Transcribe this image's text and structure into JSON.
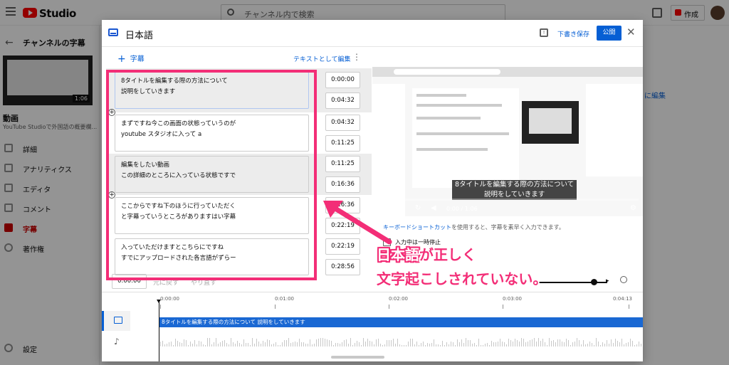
{
  "studio": {
    "logo_text": "Studio",
    "search_placeholder": "チャンネル内で検索",
    "create_label": "作成"
  },
  "sidebar": {
    "title": "チャンネルの字幕",
    "thumbnail_duration": "1:06",
    "video_title": "動画",
    "video_desc": "YouTube Studioで外国語の概要欄...",
    "items": [
      {
        "label": "詳細",
        "icon": "pencil-icon"
      },
      {
        "label": "アナリティクス",
        "icon": "analytics-icon"
      },
      {
        "label": "エディタ",
        "icon": "editor-icon"
      },
      {
        "label": "コメント",
        "icon": "comment-icon"
      },
      {
        "label": "字幕",
        "icon": "subtitles-icon"
      },
      {
        "label": "著作権",
        "icon": "copyright-icon"
      }
    ],
    "settings_label": "設定"
  },
  "background_right_text": "に編集",
  "dialog": {
    "title": "日本語",
    "save_draft": "下書き保存",
    "publish": "公開",
    "add_caption": "字幕",
    "edit_as_text": "テキストとして編集",
    "captions": [
      {
        "text1": "8タイトルを編集する際の方法について",
        "text2": "説明をしていきます",
        "start": "0:00:00",
        "end": "0:04:32"
      },
      {
        "text1": "まずですね今この画面の状態っていうのが",
        "text2": "youtube スタジオに入って a",
        "start": "0:04:32",
        "end": "0:11:25"
      },
      {
        "text1": "編集をしたい動画",
        "text2": "この詳細のところに入っている状態ですで",
        "start": "0:11:25",
        "end": "0:16:36"
      },
      {
        "text1": "ここからですね下のほうに行っていただく",
        "text2": "と字幕っていうところがありますはい字幕",
        "start": "0:16:36",
        "end": "0:22:19"
      },
      {
        "text1": "入っていただけますとこちらにですね",
        "text2": "すでにアップロードされた各言語がずらー",
        "start": "0:22:19",
        "end": "0:28:56"
      }
    ],
    "current_time": "0:00:00",
    "undo": "元に戻す",
    "redo": "やり直す",
    "preview_caption_line1": "8タイトルを編集する際の方法について",
    "preview_caption_line2": "説明をしていきます",
    "player_time": "0:00 / 1:06",
    "hint_link": "キーボードショートカット",
    "hint_text": "を使用すると、字幕を素早く入力できます。",
    "pause_label": "入力中は一時停止",
    "timeline_ticks": [
      "0:00:00",
      "0:01:00",
      "0:02:00",
      "0:03:00",
      "0:04:13"
    ],
    "timeline_caption": "8タイトルを編集する際の方法について 説明をしていきます"
  },
  "annotation": {
    "line1_a": "日本語",
    "line1_b": "が正しく",
    "line2": "文字起こしされていない。",
    "color": "#f32e77"
  }
}
